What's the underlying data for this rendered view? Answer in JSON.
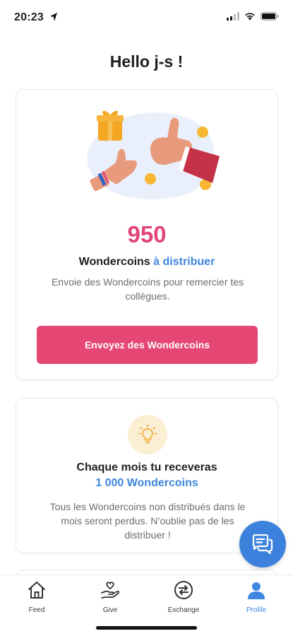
{
  "status_bar": {
    "time": "20:23",
    "icons": [
      "location-arrow-icon",
      "signal-icon",
      "wifi-icon",
      "battery-icon"
    ]
  },
  "greeting": "Hello j-s !",
  "distribute_card": {
    "amount": "950",
    "label_prefix": "Wondercoins",
    "label_accent": "à distribuer",
    "description": "Envoie des Wondercoins pour remercier tes collègues.",
    "button_label": "Envoyez des Wondercoins",
    "illustration": "thumbs-up-gift-coins-illustration"
  },
  "monthly_card": {
    "icon": "lightbulb-icon",
    "title": "Chaque mois tu receveras",
    "amount": "1 000 Wondercoins",
    "description": "Tous les Wondercoins non distribués dans le mois seront perdus. N’oublie pas de les distribuer !"
  },
  "chat_button": {
    "icon": "chat-icon"
  },
  "tab_bar": {
    "tabs": [
      {
        "label": "Feed",
        "icon": "house-icon"
      },
      {
        "label": "Give",
        "icon": "hand-heart-icon"
      },
      {
        "label": "Exchange",
        "icon": "exchange-icon"
      },
      {
        "label": "Profile",
        "icon": "person-icon"
      }
    ],
    "active": "Profile"
  },
  "colors": {
    "accent_pink": "#e54775",
    "accent_blue": "#3f86e0",
    "amount_pink": "#e24777",
    "bulb_bg": "#fbefd3"
  }
}
